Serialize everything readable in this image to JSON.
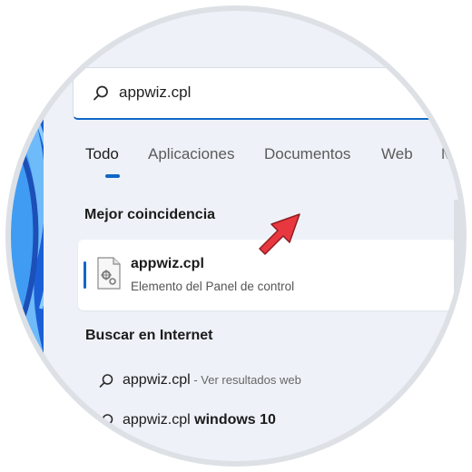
{
  "search": {
    "value": "appwiz.cpl"
  },
  "tabs": [
    {
      "label": "Todo"
    },
    {
      "label": "Aplicaciones"
    },
    {
      "label": "Documentos"
    },
    {
      "label": "Web"
    },
    {
      "label": "M"
    }
  ],
  "best_match": {
    "heading": "Mejor coincidencia",
    "title": "appwiz.cpl",
    "subtitle": "Elemento del Panel de control"
  },
  "web": {
    "heading": "Buscar en Internet",
    "results": [
      {
        "query": "appwiz.cpl",
        "suffix": " - Ver resultados web"
      },
      {
        "query": "appwiz.cpl",
        "suffix": " windows 10"
      }
    ]
  },
  "colors": {
    "accent": "#0f67c7",
    "arrow": "#e8373f",
    "panel": "#eef2f8",
    "wallpaper": "#2a7de1"
  },
  "icons": {
    "search": "search-icon",
    "control_panel": "control-panel-file-icon",
    "annotation": "red-arrow"
  }
}
